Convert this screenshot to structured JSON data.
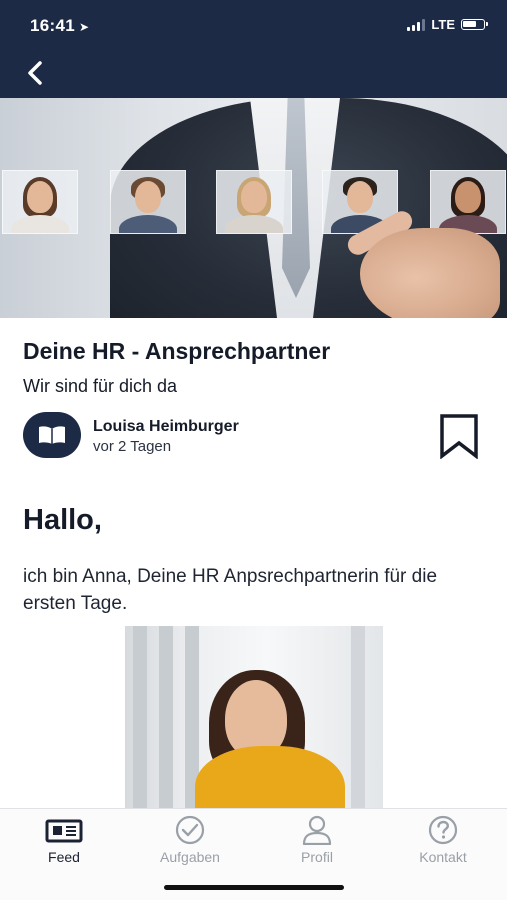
{
  "status_bar": {
    "time": "16:41",
    "network": "LTE"
  },
  "nav": {
    "back_icon": "chevron-left-icon"
  },
  "article": {
    "title": "Deine HR - Ansprechpartner",
    "subtitle": "Wir sind für dich da",
    "author": {
      "name": "Louisa Heimburger",
      "time": "vor 2 Tagen",
      "avatar_icon": "open-book-icon"
    },
    "bookmark_icon": "bookmark-icon",
    "greeting": "Hallo,",
    "intro": "ich bin Anna, Deine HR Anpsrechpartnerin für die ersten Tage."
  },
  "tabbar": {
    "tabs": [
      {
        "label": "Feed",
        "icon": "newspaper-icon",
        "active": true
      },
      {
        "label": "Aufgaben",
        "icon": "checkmark-circle-icon",
        "active": false
      },
      {
        "label": "Profil",
        "icon": "person-icon",
        "active": false
      },
      {
        "label": "Kontakt",
        "icon": "question-circle-icon",
        "active": false
      }
    ]
  },
  "colors": {
    "header_bg": "#1c2a45",
    "text": "#151b28",
    "tab_inactive": "#9aa0a8"
  }
}
